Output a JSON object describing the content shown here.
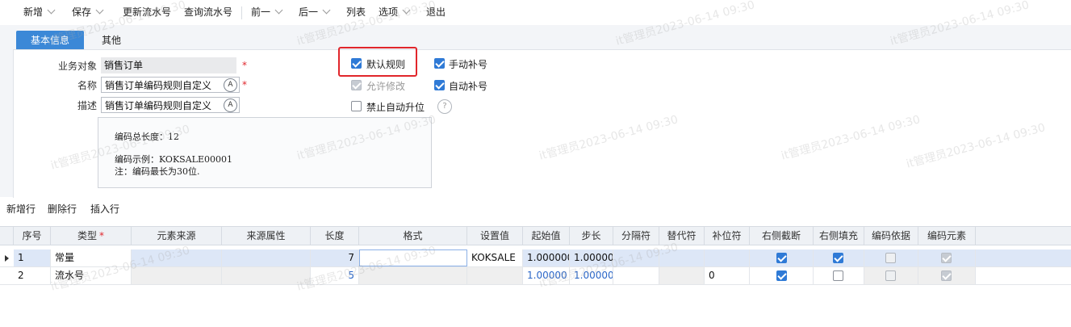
{
  "toolbar": {
    "new": "新增",
    "save": "保存",
    "update_serial": "更新流水号",
    "query_serial": "查询流水号",
    "prev": "前一",
    "next": "后一",
    "list": "列表",
    "options": "选项",
    "exit": "退出"
  },
  "tabs": {
    "basic": "基本信息",
    "other": "其他"
  },
  "form": {
    "business_object_label": "业务对象",
    "business_object_value": "销售订单",
    "name_label": "名称",
    "name_value": "销售订单编码规则自定义",
    "desc_label": "描述",
    "desc_value": "销售订单编码规则自定义",
    "required_mark": "*",
    "lang_glyph": "A"
  },
  "options": {
    "default_rule": {
      "label": "默认规则",
      "checked": true
    },
    "manual_fill": {
      "label": "手动补号",
      "checked": true
    },
    "allow_modify": {
      "label": "允许修改",
      "checked": true,
      "disabled": true
    },
    "auto_fill": {
      "label": "自动补号",
      "checked": true
    },
    "no_auto_upgrade": {
      "label": "禁止自动升位",
      "checked": false
    },
    "help_glyph": "?"
  },
  "info": {
    "total_length": "编码总长度：12",
    "example": "编码示例：KOKSALE00001",
    "note": "注：编码最长为30位."
  },
  "grid_toolbar": {
    "add_row": "新增行",
    "delete_row": "删除行",
    "insert_row": "插入行"
  },
  "grid": {
    "columns": [
      "序号",
      "类型",
      "元素来源",
      "来源属性",
      "长度",
      "格式",
      "设置值",
      "起始值",
      "步长",
      "分隔符",
      "替代符",
      "补位符",
      "右侧截断",
      "右侧填充",
      "编码依据",
      "编码元素"
    ],
    "rows": [
      {
        "seq": "1",
        "type": "常量",
        "source": "",
        "attr": "",
        "length": "7",
        "format": "",
        "value": "KOKSALE",
        "start": "1.000000",
        "step": "1.00000",
        "sep": "",
        "alt": "",
        "pad": "",
        "truncate": true,
        "fill": true,
        "basis": false,
        "element": true
      },
      {
        "seq": "2",
        "type": "流水号",
        "source": "",
        "attr": "",
        "length": "5",
        "format": "",
        "value": "",
        "start": "1.00000",
        "step": "1.00000",
        "sep": "",
        "alt": "",
        "pad": "0",
        "truncate": true,
        "fill": false,
        "basis": false,
        "element": true
      }
    ]
  },
  "watermark": "it管理员2023-06-14 09:30",
  "colors": {
    "accent": "#3b88d7",
    "highlight": "#e1262b",
    "checkbox": "#2f7ad6"
  }
}
